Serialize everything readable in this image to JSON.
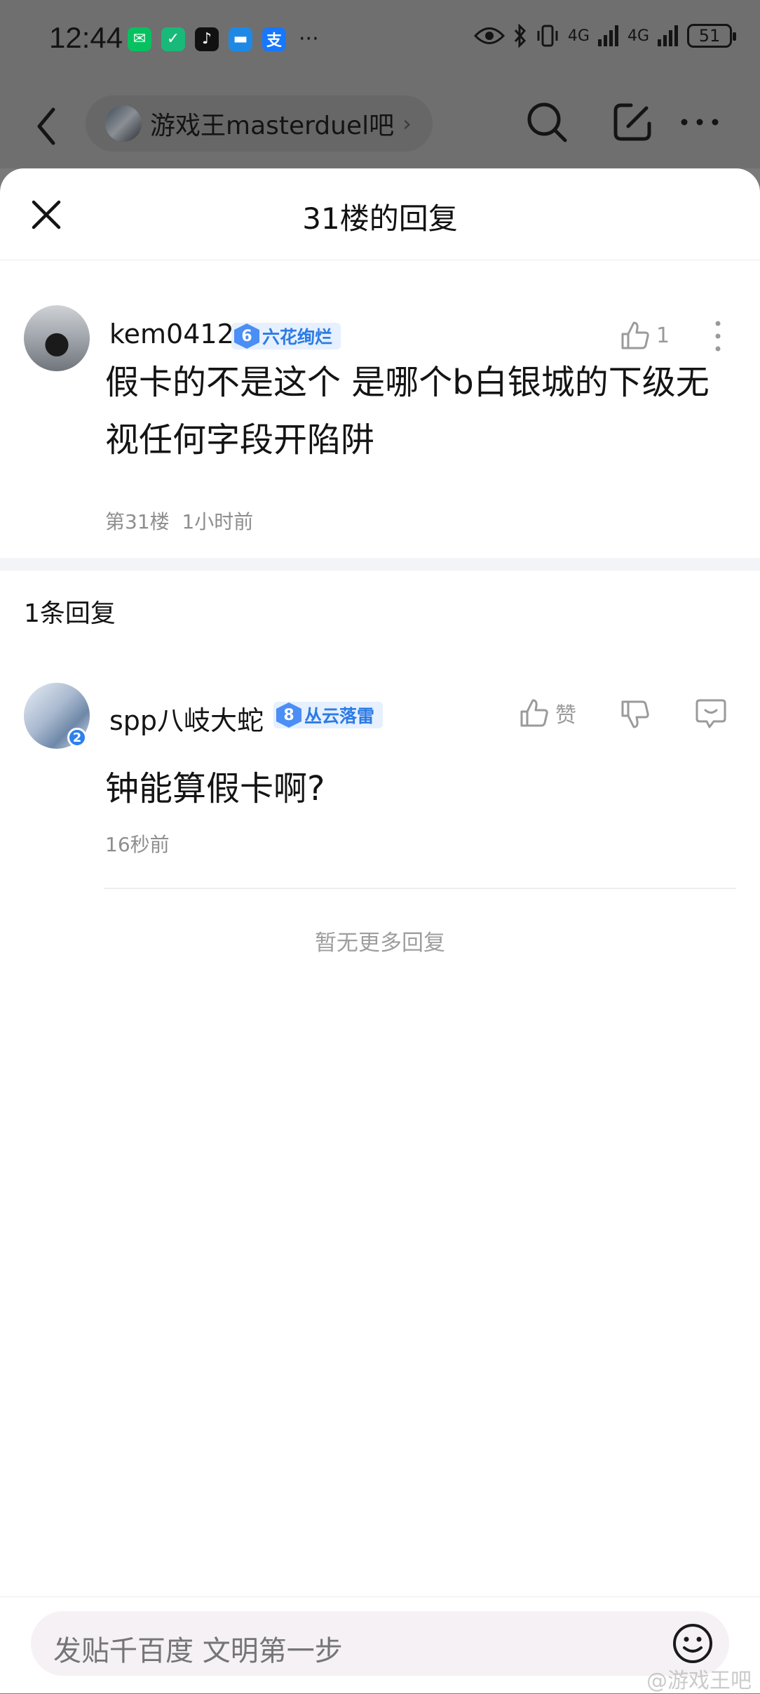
{
  "status_bar": {
    "time": "12:44",
    "apps": [
      {
        "icon": "wechat-icon",
        "glyph": "✉",
        "color": "#07c160"
      },
      {
        "icon": "shield-app-icon",
        "glyph": "✓",
        "color": "#19b97a"
      },
      {
        "icon": "tiktok-icon",
        "glyph": "♪",
        "color": "#111111"
      },
      {
        "icon": "message-app-icon",
        "glyph": "▬",
        "color": "#1e88e5"
      },
      {
        "icon": "alipay-icon",
        "glyph": "支",
        "color": "#1677ff"
      }
    ],
    "more": "···",
    "net1": "4G",
    "net2": "4G",
    "battery": "51"
  },
  "app_bar": {
    "forum_name": "游戏王masterduel吧",
    "chevron": "›"
  },
  "sheet": {
    "title": "31楼的回复"
  },
  "main_comment": {
    "username": "kem0412",
    "level": "6",
    "level_title": "六花绚烂",
    "likes": "1",
    "body": "假卡的不是这个 是哪个b白银城的下级无视任何字段开陷阱",
    "floor": "第31楼",
    "time": "1小时前"
  },
  "replies_header": "1条回复",
  "reply": {
    "username": "spp八岐大蛇",
    "avatar_badge": "2",
    "level": "8",
    "level_title": "丛云落雷",
    "like_label": "赞",
    "body": "钟能算假卡啊?",
    "time": "16秒前"
  },
  "no_more": "暂无更多回复",
  "input": {
    "placeholder": "发贴千百度 文明第一步"
  },
  "watermark": "@游戏王吧"
}
